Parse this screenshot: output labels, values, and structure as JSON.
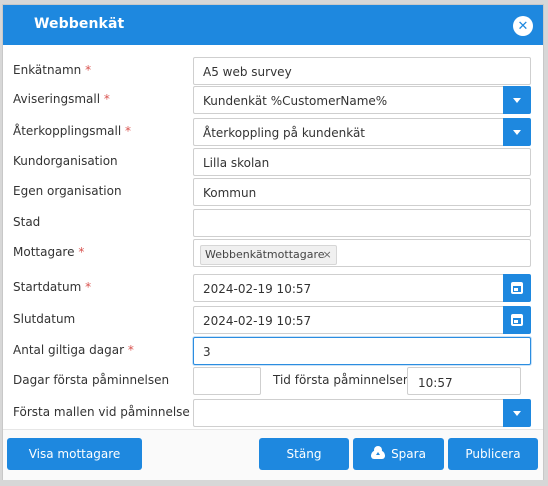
{
  "dialog": {
    "title": "Webbenkät",
    "close_symbol": "✕"
  },
  "form": {
    "required_marker": "*",
    "survey_name": {
      "label": "Enkätnamn",
      "value": "A5 web survey"
    },
    "notification_template": {
      "label": "Aviseringsmall",
      "value": "Kundenkät %CustomerName%"
    },
    "feedback_template": {
      "label": "Återkopplingsmall",
      "value": "Återkoppling på kundenkät"
    },
    "customer_org": {
      "label": "Kundorganisation",
      "value": "Lilla skolan"
    },
    "own_org": {
      "label": "Egen organisation",
      "value": "Kommun"
    },
    "city": {
      "label": "Stad",
      "value": ""
    },
    "recipients": {
      "label": "Mottagare",
      "tag": "Webbenkätmottagare",
      "tag_remove": "×"
    },
    "start_date": {
      "label": "Startdatum",
      "value": "2024-02-19 10:57"
    },
    "end_date": {
      "label": "Slutdatum",
      "value": "2024-02-19 10:57"
    },
    "valid_days": {
      "label": "Antal giltiga dagar",
      "value": "3"
    },
    "first_reminder_days": {
      "label": "Dagar första påminnelsen",
      "value": ""
    },
    "first_reminder_time": {
      "label": "Tid första påminnelsen",
      "value": "10:57"
    },
    "first_reminder_template": {
      "label": "Första mallen vid påminnelse",
      "value": ""
    }
  },
  "footer": {
    "show_recipients": "Visa mottagare",
    "close": "Stäng",
    "save": "Spara",
    "publish": "Publicera"
  },
  "colors": {
    "accent": "#1e88df",
    "required": "#d9534f"
  }
}
